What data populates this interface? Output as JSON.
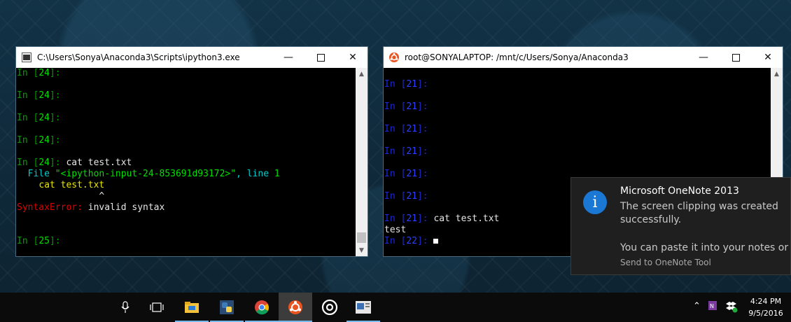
{
  "left_window": {
    "title": "C:\\Users\\Sonya\\Anaconda3\\Scripts\\ipython3.exe",
    "prompts": [
      "24",
      "24",
      "24",
      "24"
    ],
    "cmd_prompt_num": "24",
    "cmd_text": "cat test.txt",
    "error_file_line_a": "File ",
    "error_file_name": "\"<ipython-input-24-853691d93172>\"",
    "error_file_line_b": ", line ",
    "error_line_num": "1",
    "error_code": "cat test.txt",
    "error_caret": "^",
    "error_type": "SyntaxError:",
    "error_msg": "invalid syntax",
    "last_prompt_num": "25",
    "in_label": "In "
  },
  "right_window": {
    "title": "root@SONYALAPTOP: /mnt/c/Users/Sonya/Anaconda3",
    "prompt_num": "21",
    "cmd_text": "cat test.txt",
    "output": "test",
    "last_prompt_num": "22",
    "in_label": "In "
  },
  "notification": {
    "title": "Microsoft OneNote 2013",
    "body_line1": "The screen clipping was created",
    "body_line2": "successfully.",
    "body_line3": "You can paste it into your notes or in",
    "footer": "Send to OneNote Tool",
    "icon": "info-icon"
  },
  "taskbar": {
    "time": "4:24 PM",
    "date": "9/5/2016",
    "icons": [
      "microphone-icon",
      "task-view-icon",
      "file-explorer-icon",
      "python-icon",
      "chrome-icon",
      "ubuntu-icon",
      "groove-icon",
      "onenote-clip-icon"
    ],
    "colors": {
      "accent": "#76b9ed"
    }
  }
}
